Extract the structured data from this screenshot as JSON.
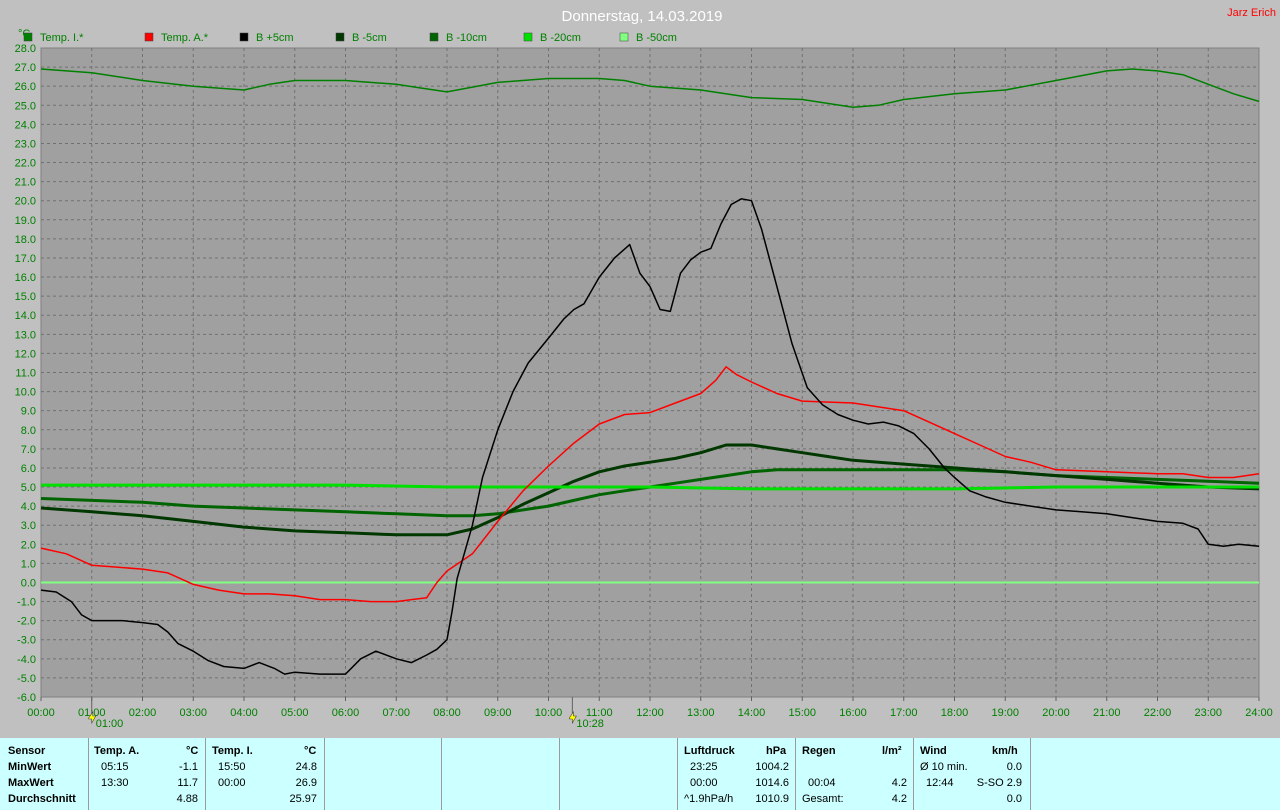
{
  "header": {
    "title": "Donnerstag, 14.03.2019",
    "author": "Jarz Erich"
  },
  "colors": {
    "temp_i": "#008000",
    "temp_a": "#ff0000",
    "b_plus5": "#000000",
    "b_minus5": "#003800",
    "b_minus10": "#006400",
    "b_minus20": "#00e000",
    "b_minus50": "#80ff80"
  },
  "chart_data": {
    "type": "line",
    "ylabel": "°C",
    "ylim": [
      -6.0,
      28.0
    ],
    "xlim": [
      0,
      24
    ],
    "y_ticks": [
      "-6.0",
      "-5.0",
      "-4.0",
      "-3.0",
      "-2.0",
      "-1.0",
      "0.0",
      "1.0",
      "2.0",
      "3.0",
      "4.0",
      "5.0",
      "6.0",
      "7.0",
      "8.0",
      "9.0",
      "10.0",
      "11.0",
      "12.0",
      "13.0",
      "14.0",
      "15.0",
      "16.0",
      "17.0",
      "18.0",
      "19.0",
      "20.0",
      "21.0",
      "22.0",
      "23.0",
      "24.0",
      "25.0",
      "26.0",
      "27.0",
      "28.0"
    ],
    "x_ticks": [
      "00:00",
      "01:00",
      "02:00",
      "03:00",
      "04:00",
      "05:00",
      "06:00",
      "07:00",
      "08:00",
      "09:00",
      "10:00",
      "11:00",
      "12:00",
      "13:00",
      "14:00",
      "15:00",
      "16:00",
      "17:00",
      "18:00",
      "19:00",
      "20:00",
      "21:00",
      "22:00",
      "23:00",
      "24:00"
    ],
    "grid": true,
    "legend_position": "top-left",
    "markers": [
      {
        "label": "01:00",
        "x": 1.0
      },
      {
        "label": "10:28",
        "x": 10.47
      }
    ],
    "series": [
      {
        "name": "Temp. I.*",
        "color": "#008000",
        "width": 1.5,
        "points": [
          [
            0,
            26.9
          ],
          [
            1,
            26.7
          ],
          [
            2,
            26.3
          ],
          [
            3,
            26.0
          ],
          [
            4,
            25.8
          ],
          [
            4.5,
            26.1
          ],
          [
            5,
            26.3
          ],
          [
            6,
            26.3
          ],
          [
            7,
            26.1
          ],
          [
            7.5,
            25.9
          ],
          [
            8,
            25.7
          ],
          [
            9,
            26.2
          ],
          [
            10,
            26.4
          ],
          [
            11,
            26.4
          ],
          [
            11.5,
            26.3
          ],
          [
            12,
            26.0
          ],
          [
            13,
            25.8
          ],
          [
            14,
            25.4
          ],
          [
            15,
            25.3
          ],
          [
            16,
            24.9
          ],
          [
            16.5,
            25.0
          ],
          [
            17,
            25.3
          ],
          [
            18,
            25.6
          ],
          [
            19,
            25.8
          ],
          [
            20,
            26.3
          ],
          [
            21,
            26.8
          ],
          [
            21.5,
            26.9
          ],
          [
            22,
            26.8
          ],
          [
            22.5,
            26.6
          ],
          [
            23,
            26.1
          ],
          [
            23.5,
            25.6
          ],
          [
            24,
            25.2
          ]
        ]
      },
      {
        "name": "Temp. A.*",
        "color": "#ff0000",
        "width": 1.5,
        "points": [
          [
            0,
            1.8
          ],
          [
            0.5,
            1.5
          ],
          [
            1,
            0.9
          ],
          [
            2,
            0.7
          ],
          [
            2.5,
            0.5
          ],
          [
            3,
            -0.1
          ],
          [
            3.5,
            -0.4
          ],
          [
            4,
            -0.6
          ],
          [
            4.5,
            -0.6
          ],
          [
            5,
            -0.7
          ],
          [
            5.5,
            -0.9
          ],
          [
            6,
            -0.9
          ],
          [
            6.5,
            -1.0
          ],
          [
            7,
            -1.0
          ],
          [
            7.3,
            -0.9
          ],
          [
            7.6,
            -0.8
          ],
          [
            7.8,
            0.0
          ],
          [
            8,
            0.6
          ],
          [
            8.5,
            1.5
          ],
          [
            9,
            3.2
          ],
          [
            9.5,
            4.8
          ],
          [
            10,
            6.1
          ],
          [
            10.5,
            7.3
          ],
          [
            11,
            8.3
          ],
          [
            11.5,
            8.8
          ],
          [
            12,
            8.9
          ],
          [
            12.5,
            9.4
          ],
          [
            13,
            9.9
          ],
          [
            13.3,
            10.6
          ],
          [
            13.5,
            11.3
          ],
          [
            13.7,
            10.9
          ],
          [
            14,
            10.5
          ],
          [
            14.5,
            9.9
          ],
          [
            15,
            9.5
          ],
          [
            16,
            9.4
          ],
          [
            17,
            9.0
          ],
          [
            17.5,
            8.4
          ],
          [
            18,
            7.8
          ],
          [
            18.5,
            7.2
          ],
          [
            19,
            6.6
          ],
          [
            19.5,
            6.3
          ],
          [
            20,
            5.9
          ],
          [
            21,
            5.8
          ],
          [
            22,
            5.7
          ],
          [
            22.5,
            5.7
          ],
          [
            23,
            5.5
          ],
          [
            23.5,
            5.5
          ],
          [
            24,
            5.7
          ]
        ]
      },
      {
        "name": "B +5cm",
        "color": "#000000",
        "width": 1.5,
        "points": [
          [
            0,
            -0.4
          ],
          [
            0.3,
            -0.5
          ],
          [
            0.6,
            -1.0
          ],
          [
            0.8,
            -1.7
          ],
          [
            1,
            -2.0
          ],
          [
            1.3,
            -2.0
          ],
          [
            1.6,
            -2.0
          ],
          [
            2,
            -2.1
          ],
          [
            2.3,
            -2.2
          ],
          [
            2.5,
            -2.6
          ],
          [
            2.7,
            -3.2
          ],
          [
            3,
            -3.6
          ],
          [
            3.3,
            -4.1
          ],
          [
            3.6,
            -4.4
          ],
          [
            4,
            -4.5
          ],
          [
            4.3,
            -4.2
          ],
          [
            4.6,
            -4.5
          ],
          [
            4.8,
            -4.8
          ],
          [
            5,
            -4.7
          ],
          [
            5.5,
            -4.8
          ],
          [
            6,
            -4.8
          ],
          [
            6.3,
            -4.0
          ],
          [
            6.6,
            -3.6
          ],
          [
            7,
            -4.0
          ],
          [
            7.3,
            -4.2
          ],
          [
            7.6,
            -3.8
          ],
          [
            7.8,
            -3.5
          ],
          [
            8,
            -3.0
          ],
          [
            8.1,
            -1.5
          ],
          [
            8.2,
            0.2
          ],
          [
            8.5,
            3.0
          ],
          [
            8.7,
            5.5
          ],
          [
            9,
            8.0
          ],
          [
            9.3,
            10.0
          ],
          [
            9.6,
            11.5
          ],
          [
            10,
            12.8
          ],
          [
            10.3,
            13.8
          ],
          [
            10.5,
            14.3
          ],
          [
            10.7,
            14.6
          ],
          [
            11,
            16.0
          ],
          [
            11.3,
            17.0
          ],
          [
            11.6,
            17.7
          ],
          [
            11.8,
            16.2
          ],
          [
            12,
            15.5
          ],
          [
            12.2,
            14.3
          ],
          [
            12.4,
            14.2
          ],
          [
            12.6,
            16.2
          ],
          [
            12.8,
            16.9
          ],
          [
            13,
            17.3
          ],
          [
            13.2,
            17.5
          ],
          [
            13.4,
            18.8
          ],
          [
            13.6,
            19.8
          ],
          [
            13.8,
            20.1
          ],
          [
            14,
            20.0
          ],
          [
            14.2,
            18.5
          ],
          [
            14.5,
            15.5
          ],
          [
            14.8,
            12.5
          ],
          [
            15.1,
            10.2
          ],
          [
            15.4,
            9.3
          ],
          [
            15.7,
            8.8
          ],
          [
            16,
            8.5
          ],
          [
            16.3,
            8.3
          ],
          [
            16.6,
            8.4
          ],
          [
            16.9,
            8.2
          ],
          [
            17.2,
            7.8
          ],
          [
            17.5,
            7.0
          ],
          [
            17.8,
            6.0
          ],
          [
            18,
            5.5
          ],
          [
            18.3,
            4.8
          ],
          [
            18.6,
            4.5
          ],
          [
            19,
            4.2
          ],
          [
            19.5,
            4.0
          ],
          [
            20,
            3.8
          ],
          [
            20.5,
            3.7
          ],
          [
            21,
            3.6
          ],
          [
            21.5,
            3.4
          ],
          [
            22,
            3.2
          ],
          [
            22.5,
            3.1
          ],
          [
            22.8,
            2.8
          ],
          [
            23,
            2.0
          ],
          [
            23.3,
            1.9
          ],
          [
            23.6,
            2.0
          ],
          [
            24,
            1.9
          ]
        ]
      },
      {
        "name": "B -5cm",
        "color": "#003800",
        "width": 3,
        "points": [
          [
            0,
            3.9
          ],
          [
            1,
            3.7
          ],
          [
            2,
            3.5
          ],
          [
            3,
            3.2
          ],
          [
            4,
            2.9
          ],
          [
            5,
            2.7
          ],
          [
            6,
            2.6
          ],
          [
            7,
            2.5
          ],
          [
            8,
            2.5
          ],
          [
            8.5,
            2.8
          ],
          [
            9,
            3.4
          ],
          [
            9.5,
            4.1
          ],
          [
            10,
            4.7
          ],
          [
            10.5,
            5.3
          ],
          [
            11,
            5.8
          ],
          [
            11.5,
            6.1
          ],
          [
            12,
            6.3
          ],
          [
            12.5,
            6.5
          ],
          [
            13,
            6.8
          ],
          [
            13.5,
            7.2
          ],
          [
            14,
            7.2
          ],
          [
            14.5,
            7.0
          ],
          [
            15,
            6.8
          ],
          [
            15.5,
            6.6
          ],
          [
            16,
            6.4
          ],
          [
            17,
            6.2
          ],
          [
            18,
            6.0
          ],
          [
            19,
            5.8
          ],
          [
            20,
            5.6
          ],
          [
            21,
            5.4
          ],
          [
            22,
            5.2
          ],
          [
            23,
            5.0
          ],
          [
            24,
            4.9
          ]
        ]
      },
      {
        "name": "B -10cm",
        "color": "#006400",
        "width": 3,
        "points": [
          [
            0,
            4.4
          ],
          [
            1,
            4.3
          ],
          [
            2,
            4.2
          ],
          [
            3,
            4.0
          ],
          [
            4,
            3.9
          ],
          [
            5,
            3.8
          ],
          [
            6,
            3.7
          ],
          [
            7,
            3.6
          ],
          [
            8,
            3.5
          ],
          [
            8.5,
            3.5
          ],
          [
            9,
            3.6
          ],
          [
            9.5,
            3.8
          ],
          [
            10,
            4.0
          ],
          [
            10.5,
            4.3
          ],
          [
            11,
            4.6
          ],
          [
            11.5,
            4.8
          ],
          [
            12,
            5.0
          ],
          [
            12.5,
            5.2
          ],
          [
            13,
            5.4
          ],
          [
            13.5,
            5.6
          ],
          [
            14,
            5.8
          ],
          [
            14.5,
            5.9
          ],
          [
            15,
            5.9
          ],
          [
            16,
            5.9
          ],
          [
            17,
            5.9
          ],
          [
            18,
            5.9
          ],
          [
            19,
            5.8
          ],
          [
            20,
            5.6
          ],
          [
            21,
            5.5
          ],
          [
            22,
            5.4
          ],
          [
            23,
            5.3
          ],
          [
            24,
            5.2
          ]
        ]
      },
      {
        "name": "B -20cm",
        "color": "#00e000",
        "width": 3,
        "points": [
          [
            0,
            5.1
          ],
          [
            2,
            5.1
          ],
          [
            4,
            5.1
          ],
          [
            6,
            5.1
          ],
          [
            8,
            5.0
          ],
          [
            10,
            5.0
          ],
          [
            12,
            5.0
          ],
          [
            14,
            4.9
          ],
          [
            16,
            4.9
          ],
          [
            18,
            4.9
          ],
          [
            20,
            5.0
          ],
          [
            22,
            5.0
          ],
          [
            24,
            5.0
          ]
        ]
      },
      {
        "name": "B -50cm",
        "color": "#80ff80",
        "width": 2,
        "points": [
          [
            0,
            0.0
          ],
          [
            24,
            0.0
          ]
        ]
      }
    ]
  },
  "table": {
    "row_labels": {
      "sensor": "Sensor",
      "min": "MinWert",
      "max": "MaxWert",
      "avg": "Durchschnitt"
    },
    "temp_a": {
      "title": "Temp. A.",
      "unit": "°C",
      "min_time": "05:15",
      "min_val": "-1.1",
      "max_time": "13:30",
      "max_val": "11.7",
      "avg": "4.88"
    },
    "temp_i": {
      "title": "Temp. I.",
      "unit": "°C",
      "min_time": "15:50",
      "min_val": "24.8",
      "max_time": "00:00",
      "max_val": "26.9",
      "avg": "25.97"
    },
    "pressure": {
      "title": "Luftdruck",
      "unit": "hPa",
      "min_time": "23:25",
      "min_val": "1004.2",
      "max_time": "00:00",
      "max_val": "1014.6",
      "trend": "^1.9hPa/h",
      "avg": "1010.9"
    },
    "rain": {
      "title": "Regen",
      "unit": "l/m²",
      "time": "00:04",
      "val": "4.2",
      "total_label": "Gesamt:",
      "total": "4.2"
    },
    "wind": {
      "title": "Wind",
      "unit": "km/h",
      "avg_label": "Ø 10 min.",
      "avg": "0.0",
      "max_time": "12:44",
      "max_val": "S-SO 2.9",
      "extra": "0.0"
    }
  }
}
